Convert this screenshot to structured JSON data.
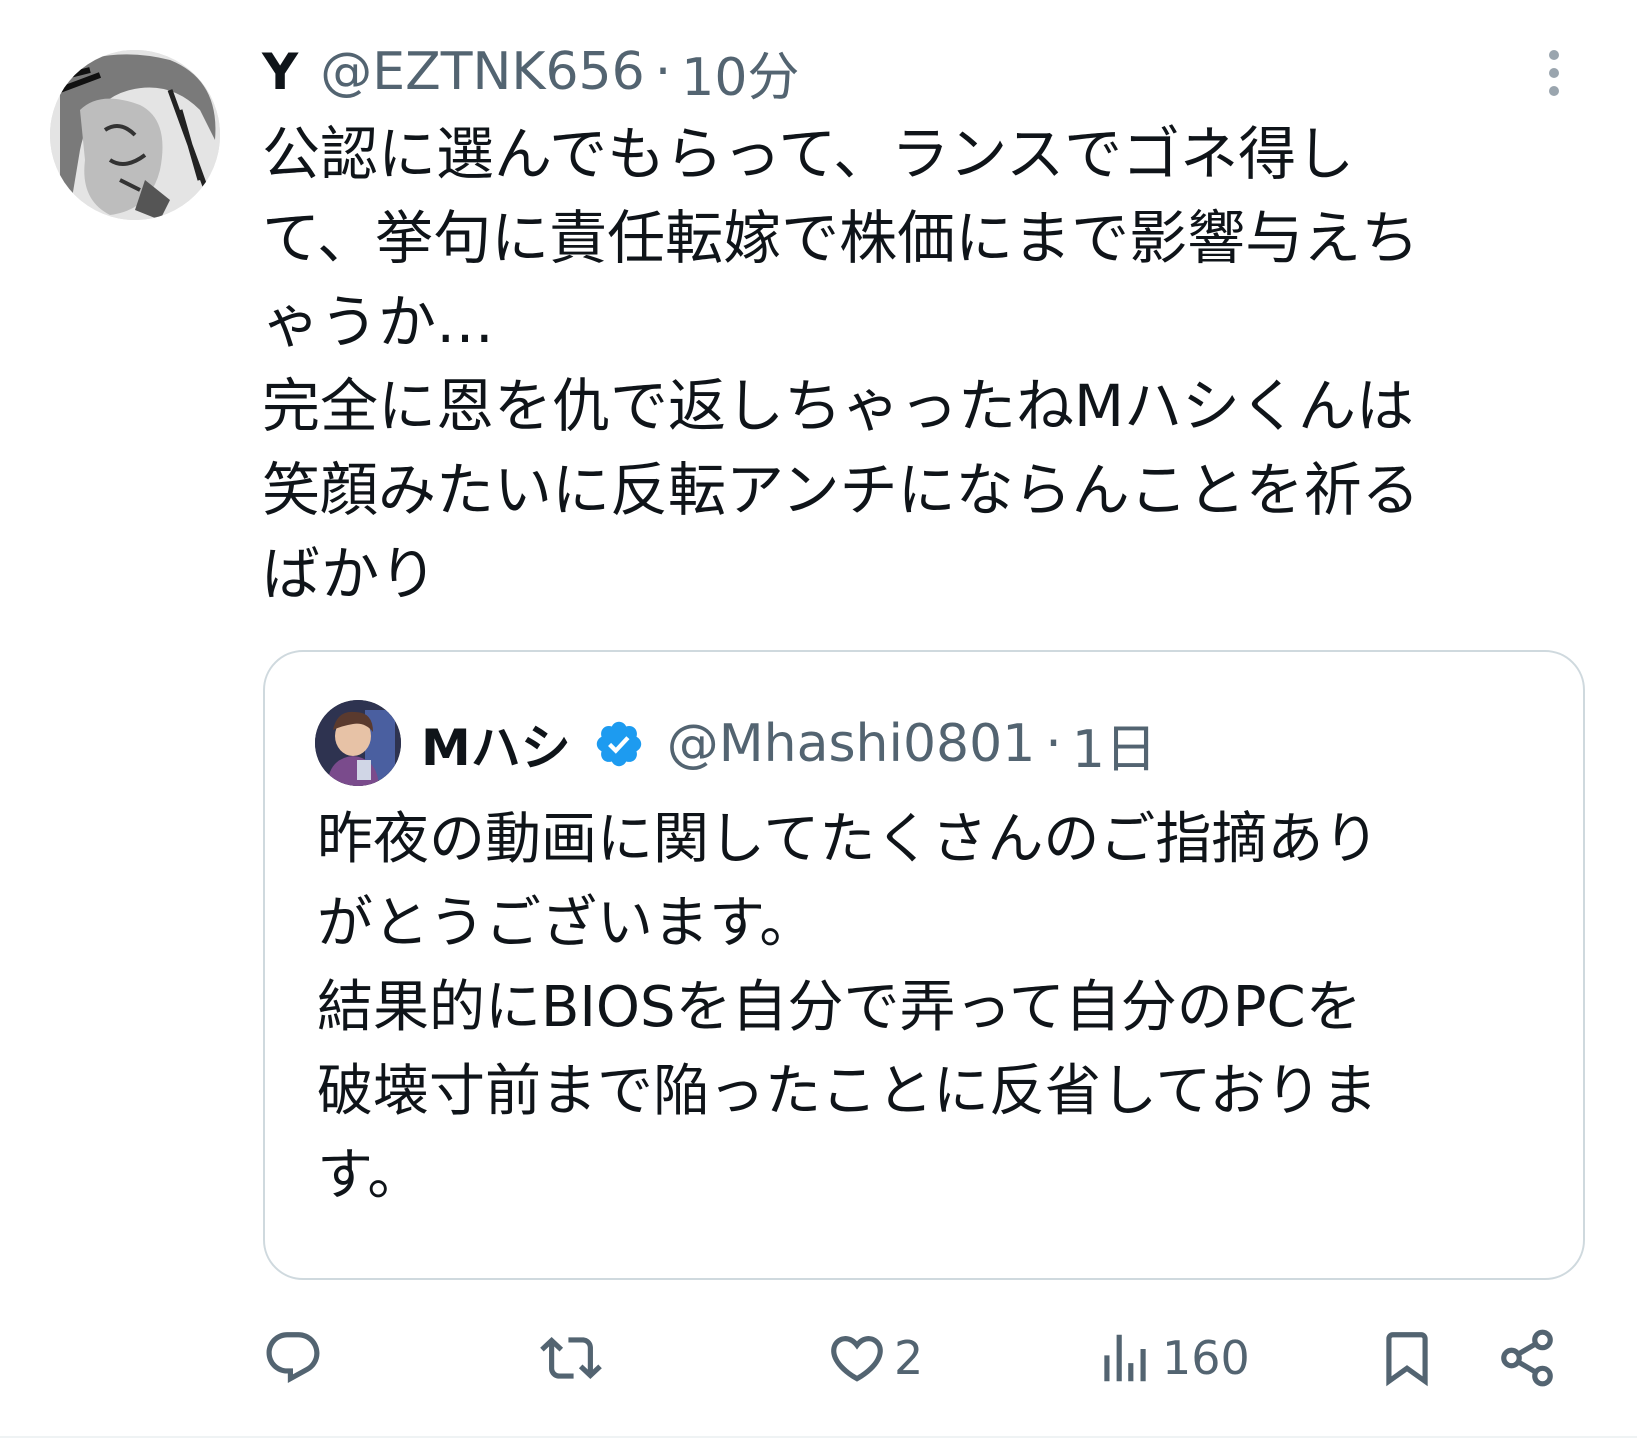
{
  "tweet": {
    "author_name": "Y",
    "author_handle": "@EZTNK656",
    "separator": "·",
    "time": "10分",
    "text": "公認に選んでもらって、ランスでゴネ得し\nて、挙句に責任転嫁で株価にまで影響与えち\nゃうか…\n完全に恩を仇で返しちゃったねMハシくんは\n笑顔みたいに反転アンチにならんことを祈る\nばかり"
  },
  "quoted_tweet": {
    "author_name": "Mハシ",
    "author_handle": "@Mhashi0801",
    "separator": "·",
    "time": "1日",
    "text": "昨夜の動画に関してたくさんのご指摘あり\nがとうございます。\n結果的にBIOSを自分で弄って自分のPCを\n破壊寸前まで陥ったことに反省しておりま\nす。",
    "verified": true
  },
  "actions": {
    "reply_count": "",
    "retweet_count": "",
    "like_count": "2",
    "views_count": "160"
  },
  "icons": {
    "reply": "reply-icon",
    "retweet": "retweet-icon",
    "like": "heart-icon",
    "views": "views-icon",
    "bookmark": "bookmark-icon",
    "share": "share-icon",
    "more": "more-icon",
    "verified": "verified-badge-icon"
  },
  "colors": {
    "text": "#0f1419",
    "secondary": "#536471",
    "verified_blue": "#1d9bf0",
    "border": "#cfd9de"
  }
}
